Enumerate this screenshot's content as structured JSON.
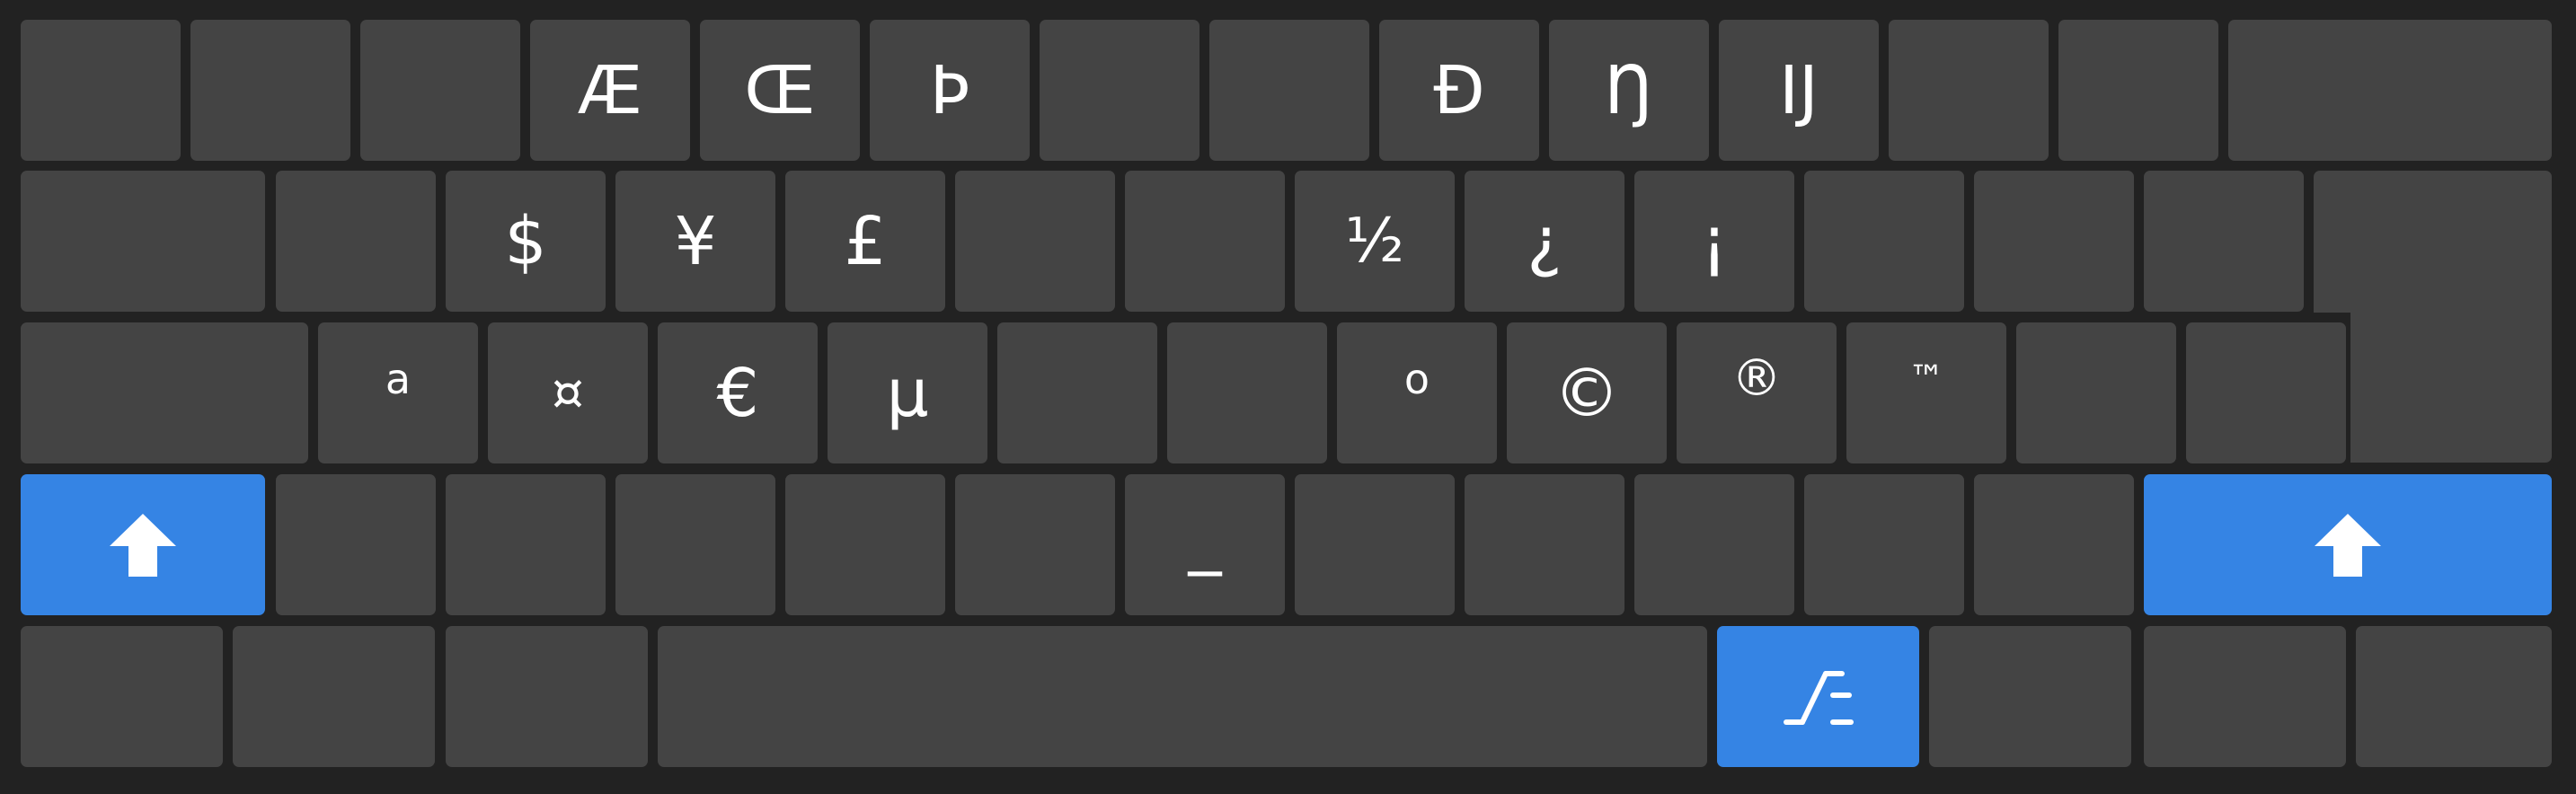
{
  "keyboard": {
    "name": "on-screen-keyboard-symbols-shift-layer",
    "colors": {
      "background": "#222222",
      "key": "#444444",
      "accent_key": "#3584e4",
      "label": "#ffffff"
    },
    "rows": [
      [
        "",
        "",
        "",
        "Æ",
        "Œ",
        "Þ",
        "",
        "",
        "Đ",
        "Ŋ",
        "Ĳ",
        "",
        "",
        ""
      ],
      [
        "",
        "",
        "$",
        "¥",
        "£",
        "",
        "",
        "½",
        "¿",
        "¡",
        "",
        "",
        "",
        ""
      ],
      [
        "",
        "a",
        "¤",
        "€",
        "μ",
        "",
        "",
        "o",
        "©",
        "®",
        "™",
        "",
        ""
      ],
      [
        "shift-icon",
        "",
        "",
        "",
        "",
        "",
        "_",
        "",
        "",
        "",
        "",
        "shift-icon"
      ],
      [
        "",
        "",
        "",
        "",
        "symbols-toggle-icon",
        "",
        "",
        ""
      ]
    ],
    "labels": {
      "ae": "Æ",
      "oe": "Œ",
      "thorn": "Þ",
      "d_stroke": "Đ",
      "eng": "Ŋ",
      "ij": "Ĳ",
      "dollar": "$",
      "yen": "¥",
      "pound": "£",
      "half": "½",
      "inv_question": "¿",
      "inv_exclaim": "¡",
      "ordinal_a": "a",
      "currency": "¤",
      "euro": "€",
      "mu": "μ",
      "ordinal_o": "o",
      "copyright": "©",
      "registered": "®",
      "trademark": "™",
      "underscore": "_"
    },
    "icons": {
      "shift_left": "shift-icon",
      "shift_right": "shift-icon",
      "symbols_toggle": "symbols-toggle-icon"
    }
  }
}
